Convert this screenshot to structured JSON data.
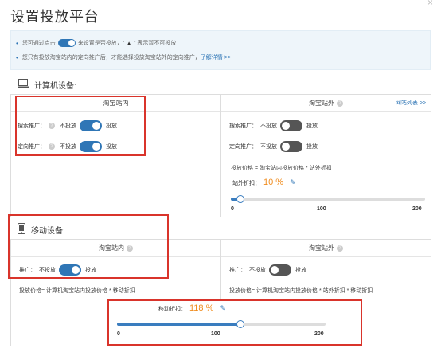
{
  "title": "设置投放平台",
  "notice": {
    "line1_pre": "您可通过点击",
    "line1_post": "来设置是否投放，“",
    "line1_warn": "▲",
    "line1_end": "” 表示暂不可投放",
    "line2": "您只有投放淘宝站内的定向推广后，才能选择投放淘宝站外的定向推广，",
    "line2_link": "了解详情 >>"
  },
  "pc_section": {
    "label": "计算机设备:"
  },
  "pc_inside": {
    "title": "淘宝站内",
    "rows": [
      {
        "label": "搜索推广：",
        "off": "不投放",
        "on": "投放",
        "state": "on"
      },
      {
        "label": "定向推广：",
        "off": "不投放",
        "on": "投放",
        "state": "on"
      }
    ]
  },
  "pc_outside": {
    "title": "淘宝站外",
    "link": "网站列表 >>",
    "rows": [
      {
        "label": "搜索推广：",
        "off": "不投放",
        "on": "投放",
        "state": "off"
      },
      {
        "label": "定向推广：",
        "off": "不投放",
        "on": "投放",
        "state": "off"
      }
    ],
    "formula": "投放价格 = 淘宝站内投放价格 * 站外折扣",
    "discount_label": "站外折扣：",
    "discount_value": "10 %",
    "slider": {
      "min": "0",
      "mid": "100",
      "max": "200",
      "percent": 5
    }
  },
  "mobile_section": {
    "label": "移动设备:"
  },
  "mobile_inside": {
    "title": "淘宝站内",
    "row": {
      "label": "推广：",
      "off": "不投放",
      "on": "投放",
      "state": "on"
    },
    "formula": "投放价格= 计算机淘宝站内投放价格 * 移动折扣"
  },
  "mobile_outside": {
    "title": "淘宝站外",
    "row": {
      "label": "推广：",
      "off": "不投放",
      "on": "投放",
      "state": "off"
    },
    "formula": "投放价格= 计算机淘宝站内投放价格 * 站外折扣 * 移动折扣"
  },
  "mobile_discount": {
    "label": "移动折扣：",
    "value": "118 %",
    "slider": {
      "min": "0",
      "mid": "100",
      "max": "200",
      "percent": 59
    }
  },
  "colors": {
    "accent": "#2f76b6",
    "highlight": "#d9342b",
    "value_orange": "#f08c1e"
  }
}
